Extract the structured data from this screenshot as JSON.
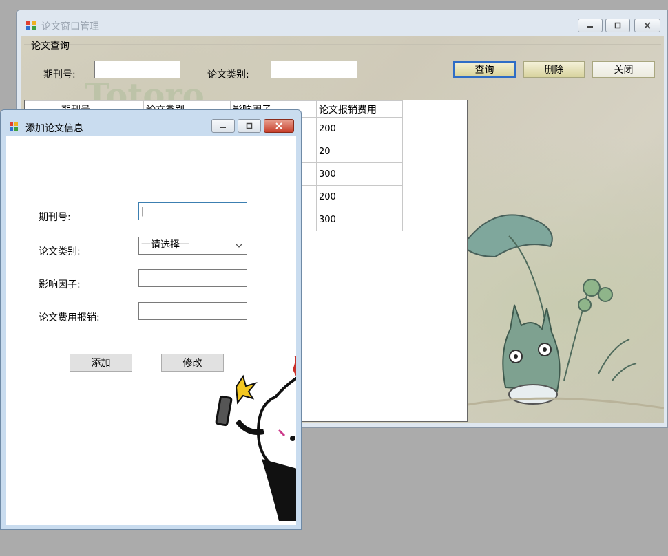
{
  "main_window": {
    "title": "论文窗口管理",
    "group_title": "论文查询",
    "issue_label": "期刊号:",
    "category_label": "论文类别:",
    "query_button": "查询",
    "delete_button": "删除",
    "close_button": "关闭",
    "watermark_text": "Totoro",
    "grid": {
      "columns": [
        "期刊号",
        "论文类别",
        "影响因子",
        "论文报销费用"
      ],
      "rows": [
        {
          "fee": "200"
        },
        {
          "fee": "20"
        },
        {
          "fee": "300"
        },
        {
          "fee": "200"
        },
        {
          "fee": "300"
        }
      ]
    }
  },
  "dialog": {
    "title": "添加论文信息",
    "issue_label": "期刊号:",
    "category_label": "论文类别:",
    "category_value": "一请选择一",
    "impact_label": "影响因子:",
    "fee_label": "论文费用报销:",
    "add_button": "添加",
    "modify_button": "修改"
  }
}
